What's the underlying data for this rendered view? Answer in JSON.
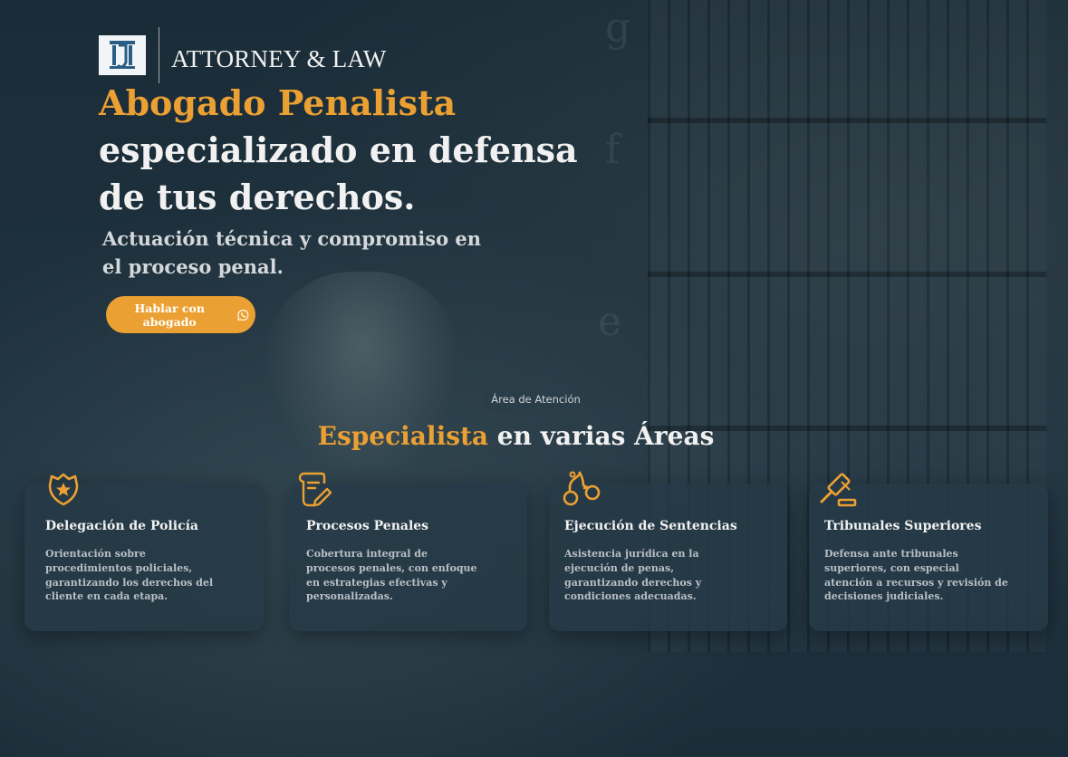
{
  "colors": {
    "accent": "#eba033",
    "background": "#1d2f3a",
    "card": "#263a46",
    "text": "#f1f1f1"
  },
  "header": {
    "logo_icon": "pillar-logo-icon",
    "brand": "ATTORNEY & LAW"
  },
  "hero": {
    "title_accent": "Abogado Penalista",
    "title_line2": "especializado en defensa",
    "title_line3": "de tus derechos.",
    "subtitle_line1": "Actuación técnica y compromiso en",
    "subtitle_line2": "el proceso penal.",
    "cta_label": "Hablar con abogado",
    "cta_icon": "whatsapp-icon"
  },
  "section": {
    "pill": "Área de Atención",
    "title_accent": "Especialista",
    "title_rest": " en varias Áreas"
  },
  "cards": [
    {
      "icon": "police-badge-icon",
      "title": "Delegación de Policía",
      "lines": [
        "Orientación sobre",
        "procedimientos policiales,",
        "garantizando los derechos del",
        "cliente en cada etapa."
      ]
    },
    {
      "icon": "document-pen-icon",
      "title": "Procesos Penales",
      "lines": [
        "Cobertura integral de",
        "procesos penales, con enfoque",
        "en estrategias efectivas y",
        "personalizadas."
      ]
    },
    {
      "icon": "handcuffs-icon",
      "title": "Ejecución de Sentencias",
      "lines": [
        "Asistencia jurídica en la",
        "ejecución de penas,",
        "garantizando derechos y",
        "condiciones adecuadas."
      ]
    },
    {
      "icon": "gavel-icon",
      "title": "Tribunales Superiores",
      "lines": [
        "Defensa ante tribunales",
        "superiores, con especial",
        "atención a recursos y revisión de",
        "decisiones judiciales."
      ]
    }
  ]
}
